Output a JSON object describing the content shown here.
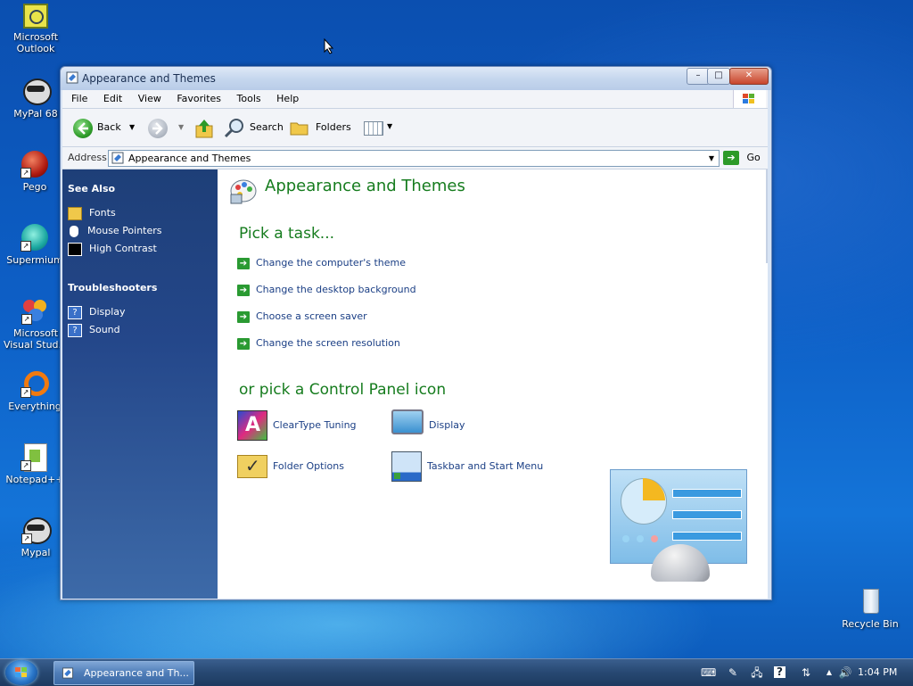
{
  "desktop": {
    "icons": [
      {
        "label": "Microsoft Outlook"
      },
      {
        "label": "MyPal 68"
      },
      {
        "label": "Pego"
      },
      {
        "label": "Supermium"
      },
      {
        "label": "Microsoft Visual Stud..."
      },
      {
        "label": "Everything"
      },
      {
        "label": "Notepad++"
      },
      {
        "label": "Mypal"
      },
      {
        "label": "Recycle Bin"
      }
    ]
  },
  "window": {
    "title": "Appearance and Themes",
    "menu": [
      "File",
      "Edit",
      "View",
      "Favorites",
      "Tools",
      "Help"
    ],
    "toolbar": {
      "back": "Back",
      "search": "Search",
      "folders": "Folders"
    },
    "address": {
      "label": "Address",
      "value": "Appearance and Themes",
      "go": "Go"
    },
    "sidebar": {
      "see_also": "See Also",
      "see_also_items": [
        "Fonts",
        "Mouse Pointers",
        "High Contrast"
      ],
      "troubleshooters": "Troubleshooters",
      "troubleshooter_items": [
        "Display",
        "Sound"
      ]
    },
    "content": {
      "heading": "Appearance and Themes",
      "pick_task": "Pick a task...",
      "tasks": [
        "Change the computer's theme",
        "Change the desktop background",
        "Choose a screen saver",
        "Change the screen resolution"
      ],
      "pick_icon": "or pick a Control Panel icon",
      "icons": [
        "ClearType Tuning",
        "Display",
        "Folder Options",
        "Taskbar and Start Menu"
      ]
    }
  },
  "taskbar": {
    "active_window": "Appearance and Th...",
    "clock": "1:04 PM"
  }
}
